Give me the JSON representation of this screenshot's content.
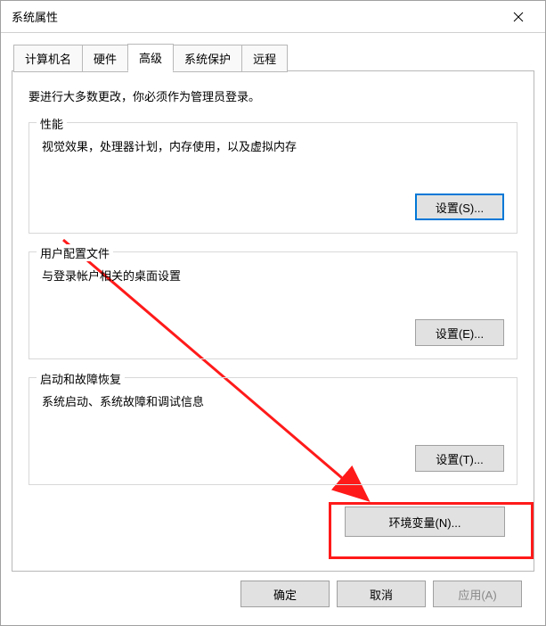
{
  "window": {
    "title": "系统属性"
  },
  "tabs": {
    "computer_name": "计算机名",
    "hardware": "硬件",
    "advanced": "高级",
    "system_protection": "系统保护",
    "remote": "远程"
  },
  "advanced_panel": {
    "intro": "要进行大多数更改，你必须作为管理员登录。",
    "performance": {
      "legend": "性能",
      "desc": "视觉效果，处理器计划，内存使用，以及虚拟内存",
      "button": "设置(S)..."
    },
    "user_profiles": {
      "legend": "用户配置文件",
      "desc": "与登录帐户相关的桌面设置",
      "button": "设置(E)..."
    },
    "startup": {
      "legend": "启动和故障恢复",
      "desc": "系统启动、系统故障和调试信息",
      "button": "设置(T)..."
    },
    "env_button": "环境变量(N)..."
  },
  "bottom": {
    "ok": "确定",
    "cancel": "取消",
    "apply": "应用(A)"
  }
}
